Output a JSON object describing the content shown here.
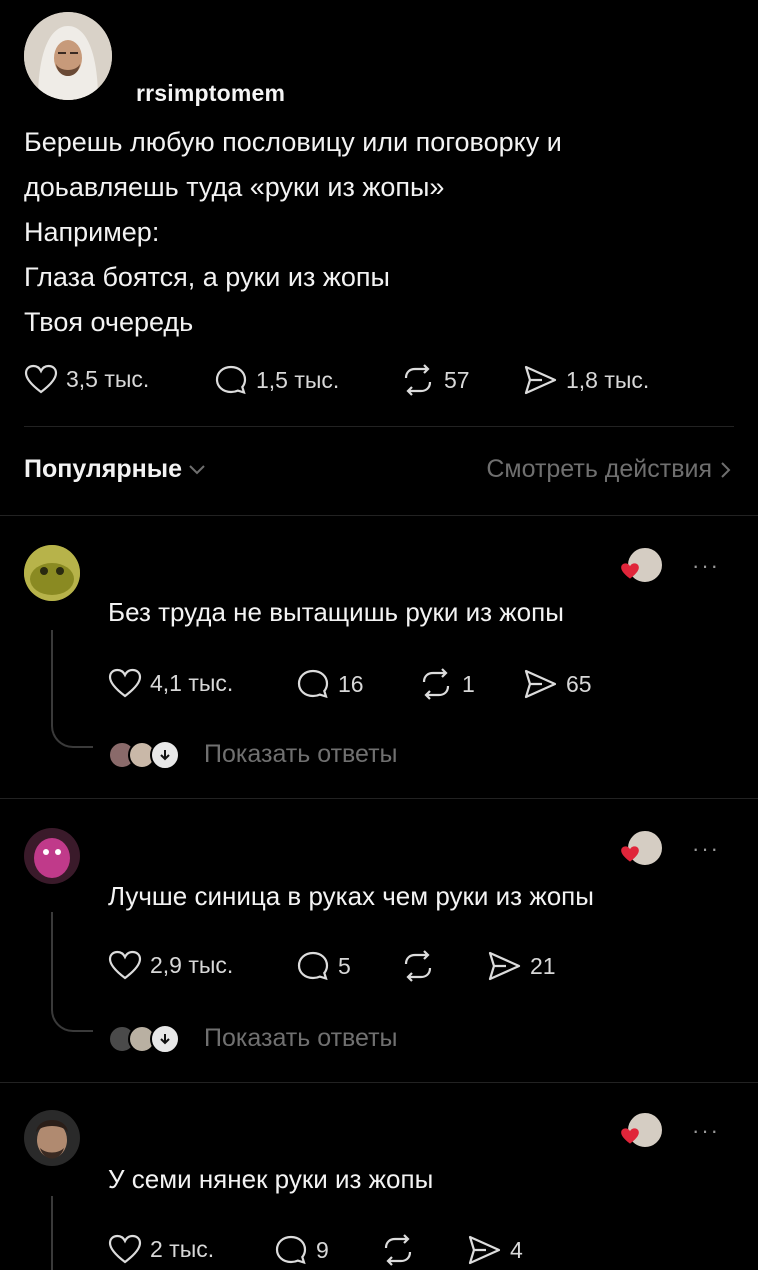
{
  "post": {
    "username": "rrsimptomem",
    "lines": [
      "Берешь любую пословицу или поговорку и",
      "доьавляешь туда «руки из жопы»",
      "Например:",
      "Глаза боятся, а руки из жопы",
      "Твоя очередь"
    ],
    "likes": "3,5 тыс.",
    "comments": "1,5 тыс.",
    "reposts": "57",
    "shares": "1,8 тыс."
  },
  "sort_label": "Популярные",
  "view_activity": "Смотреть действия",
  "replies": [
    {
      "text": "Без труда не вытащишь руки из жопы",
      "likes": "4,1 тыс.",
      "comments": "16",
      "reposts": "1",
      "shares": "65",
      "show_replies": "Показать ответы",
      "avatar_color": "#8a8a2a"
    },
    {
      "text": "Лучше синица в руках чем руки из жопы",
      "likes": "2,9 тыс.",
      "comments": "5",
      "reposts": "",
      "shares": "21",
      "show_replies": "Показать ответы",
      "avatar_color": "#b03a7a"
    },
    {
      "text": "У семи нянек руки из жопы",
      "likes": "2 тыс.",
      "comments": "9",
      "reposts": "",
      "shares": "4",
      "avatar_color": "#6a5a50"
    }
  ],
  "more_label": "···",
  "colors": {
    "heart": "#e0253a",
    "muted": "#707070"
  }
}
